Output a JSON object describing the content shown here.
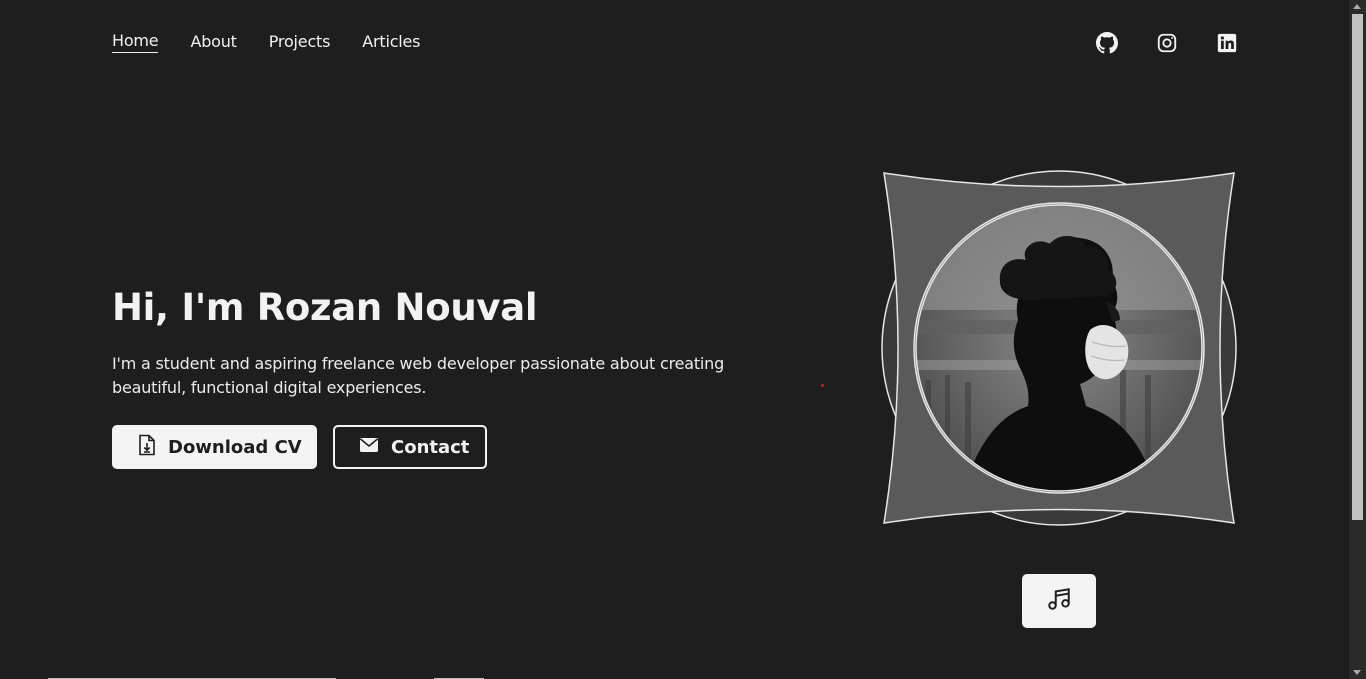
{
  "nav": {
    "items": [
      {
        "label": "Home",
        "active": true
      },
      {
        "label": "About",
        "active": false
      },
      {
        "label": "Projects",
        "active": false
      },
      {
        "label": "Articles",
        "active": false
      }
    ]
  },
  "socials": [
    {
      "icon": "github-icon"
    },
    {
      "icon": "instagram-icon"
    },
    {
      "icon": "linkedin-icon"
    }
  ],
  "hero": {
    "title": "Hi, I'm Rozan Nouval",
    "description": "I'm a student and aspiring freelance web developer passionate about creating beautiful, functional digital experiences.",
    "download_label": "Download CV",
    "contact_label": "Contact"
  },
  "music": {
    "icon": "music-note-icon"
  },
  "colors": {
    "background": "#1e1e1e",
    "text": "#f2f2f2",
    "button_light": "#f4f4f4"
  }
}
